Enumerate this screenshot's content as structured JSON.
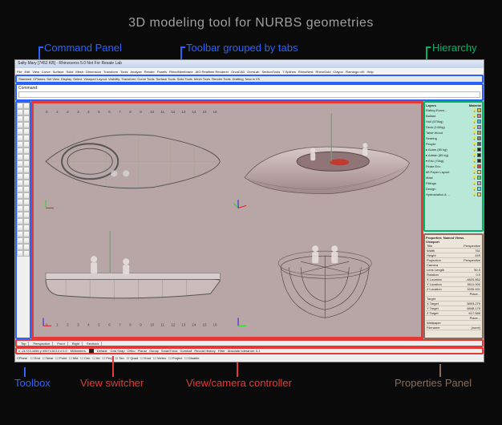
{
  "title": "3D modeling tool for NURBS geometries",
  "labels": {
    "command_panel": "Command Panel",
    "toolbar_tabs": "Toolbar grouped by tabs",
    "hierarchy": "Hierarchy",
    "toolbox": "Toolbox",
    "view_switcher": "View switcher",
    "view_camera": "View/camera controller",
    "properties_panel": "Properties Panel"
  },
  "app": {
    "titlebar": "Salty Mary [7452 KB] - Rhinoceros 5.0 Not For Resale Lab",
    "menus": [
      "File",
      "Edit",
      "View",
      "Curve",
      "Surface",
      "Solid",
      "Mesh",
      "Dimension",
      "Transform",
      "Tools",
      "Analyze",
      "Render",
      "Panels",
      "RhinoMembrane",
      "AIO Realtime Renderer",
      "OrcaCAD",
      "DomLab",
      "SectionTools",
      "T-Splines",
      "RhinoNest",
      "RhinoGold",
      "Clayoo",
      "Flamingo nXt",
      "Help"
    ],
    "tabs": [
      "Standard",
      "CPlanes",
      "Set View",
      "Display",
      "Select",
      "Viewport Layout",
      "Visibility",
      "Transform",
      "Curve Tools",
      "Surface Tools",
      "Solid Tools",
      "Mesh Tools",
      "Render Tools",
      "Drafting",
      "New in V5"
    ],
    "command_label": "Command:",
    "view_tabs": [
      "Top",
      "Perspective",
      "Front",
      "Right",
      "Sections"
    ],
    "ruler": [
      "0",
      "1",
      "2",
      "3",
      "4",
      "5",
      "6",
      "7",
      "8",
      "9",
      "10",
      "11",
      "12",
      "13",
      "14",
      "15",
      "16"
    ],
    "status1": {
      "coords": "x -21723.4496   y 49574.5213   z 0.0",
      "units": "Millimeters",
      "layer": "Default",
      "toggles": [
        "Grid Snap",
        "Ortho",
        "Planar",
        "Osnap",
        "SmartTrack",
        "Gumball",
        "Record History",
        "Filter",
        "Absolute tolerance: 0.1"
      ]
    },
    "status2": {
      "cplane": "CPlane",
      "snaps": [
        "End",
        "Near",
        "Point",
        "Mid",
        "Cen",
        "Int",
        "Perp",
        "Tan",
        "Quad",
        "Knot",
        "Vertex",
        "Project",
        "Disable"
      ]
    }
  },
  "hierarchy_panel": {
    "header": "Layers",
    "cols": "Material",
    "rows": [
      {
        "name": "Rating Exam...",
        "color": "#e9b44c"
      },
      {
        "name": "Ballast",
        "color": "#e07676"
      },
      {
        "name": "Hull (570kg)",
        "color": "#5aa8d8"
      },
      {
        "name": "Deck (140kg)",
        "color": "#a58ed0"
      },
      {
        "name": "Table Wood",
        "color": "#b89470"
      },
      {
        "name": "Searing",
        "color": "#7f7f7f"
      },
      {
        "name": "People",
        "color": "#555"
      },
      {
        "name": "▸ Azam (80 kg)",
        "color": "#222"
      },
      {
        "name": "▸ Adrian (85 kg)",
        "color": "#222"
      },
      {
        "name": "▾ Eric (70kg)",
        "color": "#222"
      },
      {
        "name": "   Pirate Eric",
        "color": "#cc4444"
      },
      {
        "name": "6ft Paper Layout",
        "color": "#e8cf78"
      },
      {
        "name": "Mast",
        "color": "#7bbf7b"
      },
      {
        "name": "Fittings",
        "color": "#d19bd1"
      },
      {
        "name": "Design",
        "color": "#7ecad1"
      },
      {
        "name": "Hydrostatics & ...",
        "color": "#ffd257"
      }
    ]
  },
  "properties_panel": {
    "tabs": [
      "Properties",
      "Named Views"
    ],
    "section": "Viewport",
    "rows": [
      {
        "k": "Title",
        "v": "Perspective"
      },
      {
        "k": "Width",
        "v": "761"
      },
      {
        "k": "Height",
        "v": "449"
      },
      {
        "k": "Projection",
        "v": "Perspective"
      },
      {
        "k": "Camera",
        "v": ""
      },
      {
        "k": "Lens Length",
        "v": "50.0"
      },
      {
        "k": "Rotation",
        "v": "0.0"
      },
      {
        "k": "X Location",
        "v": "-4820.862"
      },
      {
        "k": "Y Location",
        "v": "5511.000"
      },
      {
        "k": "Z Location",
        "v": "3335.491"
      },
      {
        "k": "",
        "v": "Place..."
      },
      {
        "k": "Target",
        "v": ""
      },
      {
        "k": "X Target",
        "v": "5893.279"
      },
      {
        "k": "Y Target",
        "v": "6848.175"
      },
      {
        "k": "Z Target",
        "v": "617.588"
      },
      {
        "k": "",
        "v": "Place..."
      },
      {
        "k": "Wallpaper",
        "v": ""
      },
      {
        "k": "Filename",
        "v": "(none)"
      }
    ]
  },
  "colors": {
    "blue": "#2962ff",
    "red": "#e53935",
    "green": "#00b366",
    "brown": "#8a6d5a"
  }
}
